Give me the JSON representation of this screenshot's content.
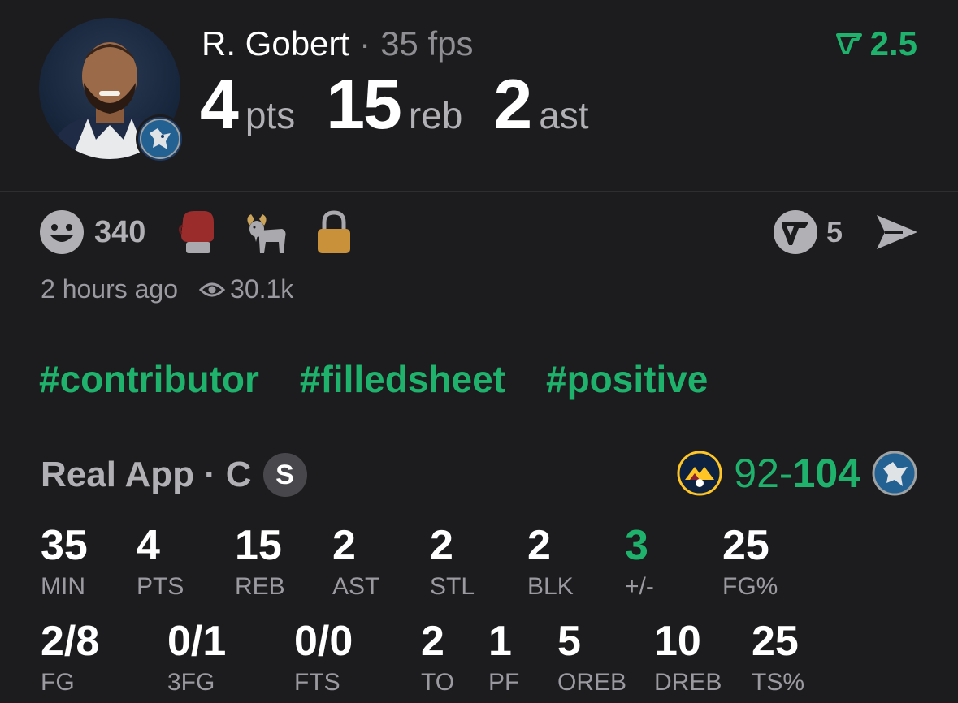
{
  "player": {
    "name": "R. Gobert",
    "fantasy_points": "35 fps",
    "separator": "·"
  },
  "headline_stats": [
    {
      "value": "4",
      "unit": "pts"
    },
    {
      "value": "15",
      "unit": "reb"
    },
    {
      "value": "2",
      "unit": "ast"
    }
  ],
  "rating": {
    "value": "2.5",
    "color": "#1fb26c"
  },
  "reactions": {
    "smiley_count": "340",
    "emojis": [
      "boxing-glove",
      "goat",
      "lock"
    ],
    "shares_count": "5"
  },
  "meta": {
    "posted": "2 hours ago",
    "views": "30.1k"
  },
  "hashtags": [
    "#contributor",
    "#filledsheet",
    "#positive"
  ],
  "game": {
    "source": "Real App",
    "separator": "·",
    "position": "C",
    "status_badge": "S",
    "away_score": "92-",
    "home_score": "104",
    "away_team_icon": "nuggets-logo",
    "home_team_icon": "timberwolves-logo"
  },
  "stats_row1": [
    {
      "value": "35",
      "label": "MIN"
    },
    {
      "value": "4",
      "label": "PTS"
    },
    {
      "value": "15",
      "label": "REB"
    },
    {
      "value": "2",
      "label": "AST"
    },
    {
      "value": "2",
      "label": "STL"
    },
    {
      "value": "2",
      "label": "BLK"
    },
    {
      "value": "3",
      "label": "+/-"
    },
    {
      "value": "25",
      "label": "FG%"
    }
  ],
  "stats_row2": [
    {
      "value": "2/8",
      "label": "FG"
    },
    {
      "value": "0/1",
      "label": "3FG"
    },
    {
      "value": "0/0",
      "label": "FTS"
    },
    {
      "value": "2",
      "label": "TO"
    },
    {
      "value": "1",
      "label": "PF"
    },
    {
      "value": "5",
      "label": "OREB"
    },
    {
      "value": "10",
      "label": "DREB"
    },
    {
      "value": "25",
      "label": "TS%"
    }
  ],
  "colors": {
    "accent": "#1fb26c",
    "background": "#1c1c1e",
    "muted": "#9a9aa0"
  }
}
